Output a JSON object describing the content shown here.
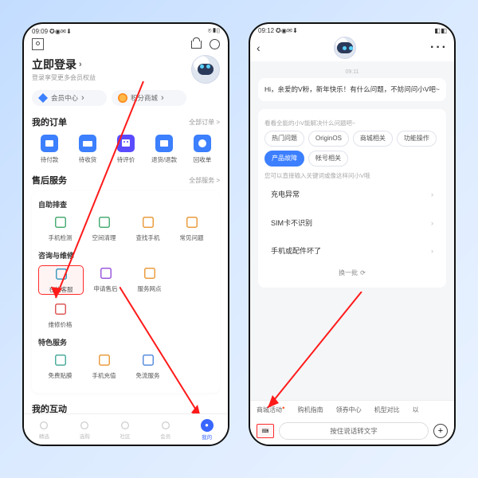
{
  "left": {
    "status": {
      "time": "09:09",
      "icons": "✪ ◉ ✉ ⬇",
      "right": "⌾ ▮▯"
    },
    "login": {
      "title": "立即登录",
      "sub": "登录享受更多会员权益"
    },
    "pills": {
      "member": "会员中心",
      "mall": "积分商城"
    },
    "orders": {
      "title": "我的订单",
      "more": "全部订单 >",
      "items": [
        "待付款",
        "待收货",
        "待评价",
        "退货/退款",
        "回收单"
      ]
    },
    "service": {
      "title": "售后服务",
      "more": "全部服务 >",
      "g1": {
        "title": "自助排查",
        "items": [
          "手机检测",
          "空间清理",
          "查找手机",
          "常见问题"
        ]
      },
      "g2": {
        "title": "咨询与维修",
        "items": [
          "在线客服",
          "申请售后",
          "服务网点",
          "维修价格"
        ]
      },
      "g3": {
        "title": "特色服务",
        "items": [
          "免费贴膜",
          "手机充值",
          "免流服务"
        ]
      }
    },
    "interact": {
      "title": "我的互动"
    },
    "nav": [
      "精选",
      "选购",
      "社区",
      "会员",
      "我的"
    ]
  },
  "right": {
    "status": {
      "time": "09:12",
      "icons": "✪ ◉ ✉ ⬇",
      "right": "◧ ▮▯"
    },
    "ts": "09:11",
    "greet": "Hi，亲爱的V粉，新年快乐！有什么问题，不妨问问小V吧~",
    "hint": "看看全能的小V能解决什么问题吧~",
    "cats": [
      "热门问题",
      "OriginOS",
      "商城相关",
      "功能操作",
      "产品故障",
      "帐号相关"
    ],
    "tip": "您可以直接输入关键词或像这样问小V哦",
    "rows": [
      "充电异常",
      "SIM卡不识别",
      "手机或配件坏了"
    ],
    "refresh": "换一批",
    "quick": [
      "商城活动",
      "购机指南",
      "领券中心",
      "机型对比",
      "以"
    ],
    "voice": "按住说话转文字"
  }
}
